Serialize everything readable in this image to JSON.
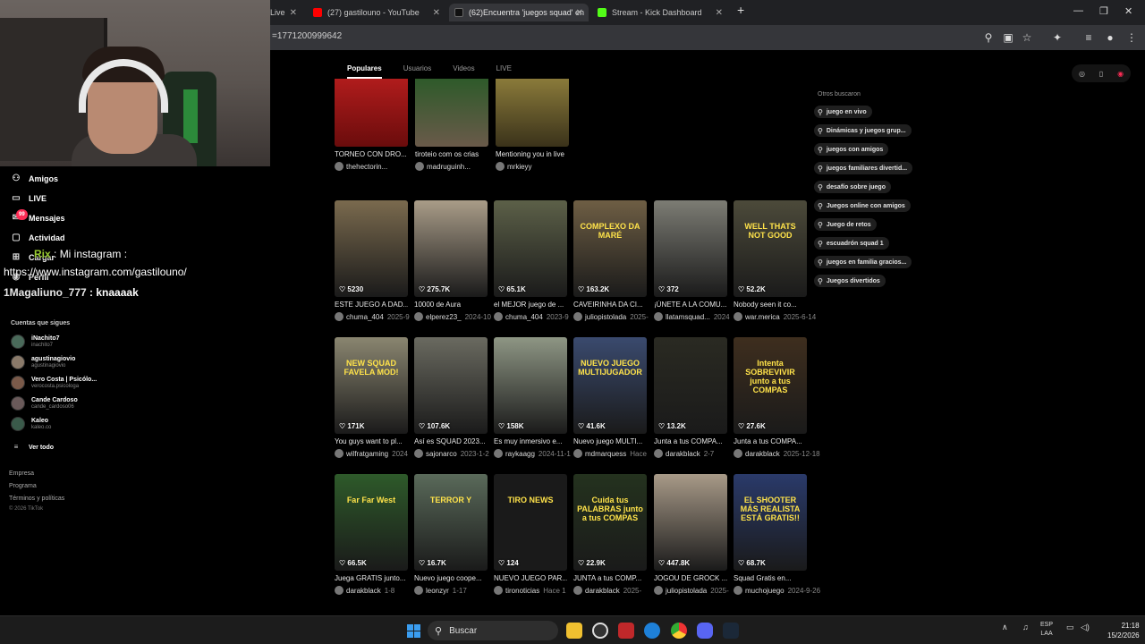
{
  "browser": {
    "tabs": [
      {
        "label": "Live",
        "icon": "tiktok-live-icon"
      },
      {
        "label": "(27) gastilouno - YouTube",
        "icon": "youtube-icon"
      },
      {
        "label": "(62)Encuentra 'juegos squad' en",
        "icon": "tiktok-icon"
      },
      {
        "label": "Stream - Kick Dashboard",
        "icon": "kick-icon"
      }
    ],
    "url": "=1771200999642"
  },
  "sidebar": {
    "nav": [
      {
        "label": "Amigos",
        "icon": "friends-icon"
      },
      {
        "label": "LIVE",
        "icon": "live-icon"
      },
      {
        "label": "Mensajes",
        "icon": "messages-icon",
        "badge": "99"
      },
      {
        "label": "Actividad",
        "icon": "activity-icon"
      },
      {
        "label": "Cargar",
        "icon": "upload-icon"
      },
      {
        "label": "Perfil",
        "icon": "profile-icon"
      }
    ],
    "chat": [
      {
        "user": "Rix",
        "text": " : Mi instagram :"
      },
      {
        "user": "",
        "text": "https://www.instagram.com/gastilouno/"
      },
      {
        "user": "1Magaliuno_777",
        "text": " : knaaaak"
      }
    ],
    "following_title": "Cuentas que sigues",
    "following": [
      {
        "name": "iNachito7",
        "handle": "inachito7"
      },
      {
        "name": "agustinagiovio",
        "handle": "agustinagiovio"
      },
      {
        "name": "Vero Costa | Psicólo...",
        "handle": "verocosta.psicologa"
      },
      {
        "name": "Cande Cardoso",
        "handle": "cande_cardoso06"
      },
      {
        "name": "Kaleo",
        "handle": "kaleo.co"
      }
    ],
    "see_all": "Ver todo",
    "footer": [
      "Empresa",
      "Programa",
      "Términos y políticas"
    ],
    "copyright": "© 2026 TikTok"
  },
  "search_tabs": [
    {
      "label": "Populares",
      "active": true
    },
    {
      "label": "Usuarios",
      "active": false
    },
    {
      "label": "Videos",
      "active": false
    },
    {
      "label": "LIVE",
      "active": false
    }
  ],
  "top_row": [
    {
      "caption": "TORNEO CON DRO...",
      "author": "thehectorin...",
      "color": "#8a1414"
    },
    {
      "caption": "tiroteio com os crias",
      "author": "madruguinh...",
      "color": "#3c5a3a"
    },
    {
      "caption": "Mentioning you in live",
      "author": "mrkieyy",
      "color": "#6a5a2a"
    }
  ],
  "rows": [
    [
      {
        "likes": "5230",
        "caption": "ESTE JUEGO A DAD...",
        "author": "chuma_404",
        "date": "2025-9",
        "color": "#7a6a4e",
        "overlay": ""
      },
      {
        "likes": "275.7K",
        "caption": "10000 de Aura",
        "author": "elperez23_",
        "date": "2024-10",
        "color": "#a99c88",
        "overlay": ""
      },
      {
        "likes": "65.1K",
        "caption": "el MEJOR juego de ...",
        "author": "chuma_404",
        "date": "2023-9",
        "color": "#5c6048",
        "overlay": ""
      },
      {
        "likes": "163.2K",
        "caption": "CAVEIRINHA DA CI...",
        "author": "juliopistolada",
        "date": "2025-",
        "color": "#6e5e44",
        "overlay": "COMPLEXO DA MARÉ"
      },
      {
        "likes": "372",
        "caption": "¡ÚNETE A LA COMU...",
        "author": "llatamsquad...",
        "date": "2024",
        "color": "#7c7c74",
        "overlay": ""
      },
      {
        "likes": "52.2K",
        "caption": "Nobody seen it co...",
        "author": "war.merica",
        "date": "2025-6-14",
        "color": "#4c4a3a",
        "overlay": "WELL THATS NOT GOOD"
      }
    ],
    [
      {
        "likes": "171K",
        "caption": "You guys want to pl...",
        "author": "wilfratgaming",
        "date": "2024",
        "color": "#8a8670",
        "overlay": "NEW SQUAD FAVELA MOD!"
      },
      {
        "likes": "107.6K",
        "caption": "Así es SQUAD 2023...",
        "author": "sajonarco",
        "date": "2023-1-2",
        "color": "#6a6a60",
        "overlay": ""
      },
      {
        "likes": "158K",
        "caption": "Es muy inmersivo e...",
        "author": "raykaagg",
        "date": "2024-11-1",
        "color": "#8e9684",
        "overlay": ""
      },
      {
        "likes": "41.6K",
        "caption": "Nuevo juego MULTI...",
        "author": "mdmarquess",
        "date": "Hace",
        "color": "#3a4a6e",
        "overlay": "NUEVO JUEGO MULTIJUGADOR"
      },
      {
        "likes": "13.2K",
        "caption": "Junta a tus COMPA...",
        "author": "darakblack",
        "date": "2-7",
        "color": "#2a2a22",
        "overlay": ""
      },
      {
        "likes": "27.6K",
        "caption": "Junta a tus COMPA...",
        "author": "darakblack",
        "date": "2025-12-18",
        "color": "#3e2e1e",
        "overlay": "Intenta SOBREVIVIR junto a tus COMPAS"
      }
    ],
    [
      {
        "likes": "66.5K",
        "caption": "Juega GRATIS junto...",
        "author": "darakblack",
        "date": "1-8",
        "color": "#2e5a2a",
        "overlay": "Far Far West"
      },
      {
        "likes": "16.7K",
        "caption": "Nuevo juego coope...",
        "author": "leonzyr",
        "date": "1-17",
        "color": "#5a6a5a",
        "overlay": "TERROR Y"
      },
      {
        "likes": "124",
        "caption": "NUEVO JUEGO PAR...",
        "author": "tironoticias",
        "date": "Hace 1",
        "color": "#1a1a1a",
        "overlay": "TIRO NEWS"
      },
      {
        "likes": "22.9K",
        "caption": "JUNTA a tus COMP...",
        "author": "darakblack",
        "date": "2025-",
        "color": "#24321e",
        "overlay": "Cuida tus PALABRAS junto a tus COMPAS"
      },
      {
        "likes": "447.8K",
        "caption": "JOGOU DE GROCK ...",
        "author": "juliopistolada",
        "date": "2025-",
        "color": "#a89a88",
        "overlay": ""
      },
      {
        "likes": "68.7K",
        "caption": "Squad Gratis en...",
        "author": "muchojuego",
        "date": "2024-9-26",
        "color": "#2a3a6a",
        "overlay": "EL SHOOTER MÁS REALISTA ESTÁ GRATIS!!"
      }
    ]
  ],
  "others_title": "Otros buscaron",
  "suggestions": [
    "juego en vivo",
    "Dinámicas y juegos grup...",
    "juegos con amigos",
    "juegos familiares divertid...",
    "desafío sobre juego",
    "Juegos online con amigos",
    "Juego de retos",
    "escuadrón squad 1",
    "juegos en familia gracios...",
    "Juegos divertidos"
  ],
  "taskbar": {
    "search_placeholder": "Buscar",
    "lang_top": "ESP",
    "lang_bottom": "LAA",
    "time": "21:18",
    "date": "15/2/2026"
  },
  "colors": {
    "accent": "#fe2c55",
    "windows_blue": "#3a9df0"
  }
}
